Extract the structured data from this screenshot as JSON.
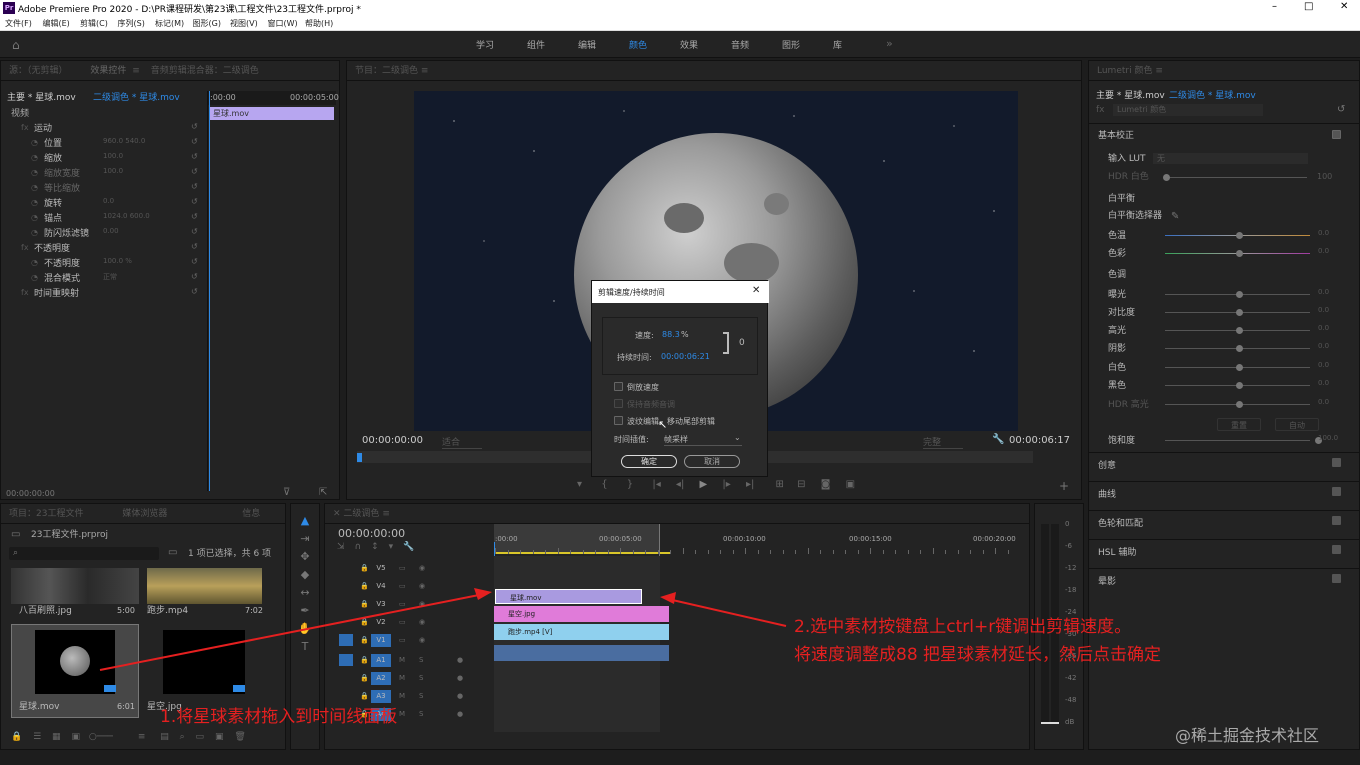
{
  "window": {
    "app_icon": "Pr",
    "title": "Adobe Premiere Pro 2020 - D:\\PR课程研发\\第23课\\工程文件\\23工程文件.prproj *",
    "minimize": "–",
    "maximize": "□",
    "close": "✕"
  },
  "menu": [
    "文件(F)",
    "编辑(E)",
    "剪辑(C)",
    "序列(S)",
    "标记(M)",
    "图形(G)",
    "视图(V)",
    "窗口(W)",
    "帮助(H)"
  ],
  "workspace": {
    "tabs": [
      "学习",
      "组件",
      "编辑",
      "颜色",
      "效果",
      "音频",
      "图形",
      "库"
    ],
    "active": "颜色",
    "more": "»"
  },
  "effect_controls": {
    "tabs": [
      "源：（无剪辑）",
      "效果控件",
      "音频剪辑混合器：二级调色"
    ],
    "source": "主要 * 星球.mov",
    "sequence": "二级调色 * 星球.mov",
    "video_label": "视频",
    "props": [
      {
        "name": "运动",
        "value": ""
      },
      {
        "name": "位置",
        "value": "960.0     540.0"
      },
      {
        "name": "缩放",
        "value": "100.0"
      },
      {
        "name": "缩放宽度",
        "value": "100.0"
      },
      {
        "name": "等比缩放",
        "value": ""
      },
      {
        "name": "旋转",
        "value": "0.0"
      },
      {
        "name": "锚点",
        "value": "1024.0     600.0"
      },
      {
        "name": "防闪烁滤镜",
        "value": "0.00"
      },
      {
        "name": "不透明度",
        "value": ""
      },
      {
        "name": "不透明度",
        "value": "100.0 %"
      },
      {
        "name": "混合模式",
        "value": "正常"
      },
      {
        "name": "时间重映射",
        "value": ""
      }
    ],
    "ruler_start": ":00:00",
    "ruler_end": "00:00:05:00",
    "clip": "星球.mov",
    "timecode": "00:00:00:00"
  },
  "program": {
    "header": "节目：二级调色",
    "tc_left": "00:00:00:00",
    "fit": "适合",
    "quality": "完整",
    "tc_right": "00:00:06:17"
  },
  "dialog": {
    "title": "剪辑速度/持续时间",
    "close": "✕",
    "speed_label": "速度:",
    "speed_value": "88.3",
    "speed_unit": "%",
    "duration_label": "持续时间:",
    "duration_value": "00:00:06:21",
    "reverse": "倒放速度",
    "maintain_pitch": "保持音频音调",
    "ripple": "波纹编辑，移动尾部剪辑",
    "interp_label": "时间插值:",
    "interp_value": "帧采样",
    "ok": "确定",
    "cancel": "取消"
  },
  "lumetri": {
    "header": "Lumetri 颜色",
    "source": "主要 * 星球.mov",
    "sequence": "二级调色 * 星球.mov",
    "fx": "Lumetri 颜色",
    "basic": "基本校正",
    "input_lut": "输入 LUT",
    "lut_value": "无",
    "hdr": "HDR 白色",
    "hdr_val": "100",
    "wb": "白平衡",
    "wb_selector": "白平衡选择器",
    "temp": "色温",
    "tint": "色彩",
    "tone": "色调",
    "sliders": [
      {
        "name": "色温",
        "val": "0.0"
      },
      {
        "name": "色彩",
        "val": "0.0"
      },
      {
        "name": "曝光",
        "val": "0.0"
      },
      {
        "name": "对比度",
        "val": "0.0"
      },
      {
        "name": "高光",
        "val": "0.0"
      },
      {
        "name": "阴影",
        "val": "0.0"
      },
      {
        "name": "白色",
        "val": "0.0"
      },
      {
        "name": "黑色",
        "val": "0.0"
      },
      {
        "name": "HDR 高光",
        "val": "0.0"
      },
      {
        "name": "饱和度",
        "val": "100.0"
      }
    ],
    "reset": "重置",
    "auto": "自动",
    "sections": [
      "创意",
      "曲线",
      "色轮和匹配",
      "HSL 辅助",
      "晕影"
    ]
  },
  "project": {
    "tabs": [
      "项目：23工程文件",
      "媒体浏览器",
      "信息"
    ],
    "file": "23工程文件.prproj",
    "selection": "1 项已选择，共 6 项",
    "items": [
      {
        "name": "八百刷照.jpg",
        "dur": "5:00"
      },
      {
        "name": "跑步.mp4",
        "dur": "7:02"
      },
      {
        "name": "星球.mov",
        "dur": "6:01"
      },
      {
        "name": "星空.jpg",
        "dur": ""
      }
    ]
  },
  "timeline": {
    "tab": "二级调色",
    "timecode": "00:00:00:00",
    "ruler": [
      ":00:00",
      "00:00:05:00",
      "00:00:10:00",
      "00:00:15:00",
      "00:00:20:00"
    ],
    "tracks": [
      "V5",
      "V4",
      "V3",
      "V2",
      "V1",
      "A1",
      "A2",
      "A3",
      "A4"
    ],
    "clips": [
      {
        "name": "星球.mov"
      },
      {
        "name": "星空.jpg"
      },
      {
        "name": "跑步.mp4 [V]"
      }
    ]
  },
  "meter": [
    "0",
    "-6",
    "-12",
    "-18",
    "-24",
    "-30",
    "-36",
    "-42",
    "-48",
    "dB"
  ],
  "annotations": {
    "step1": "1.将星球素材拖入到时间线面板",
    "step2a": "2.选中素材按键盘上ctrl+r键调出剪辑速度。",
    "step2b": "将速度调整成88 把星球素材延长，然后点击确定"
  },
  "watermark": "@稀土掘金技术社区",
  "colors": {
    "accent": "#2e8ae6",
    "clip_purple": "#a99ae0",
    "clip_pink": "#e07bd9",
    "clip_cyan": "#8fd0ee",
    "annotation": "#e52020"
  }
}
